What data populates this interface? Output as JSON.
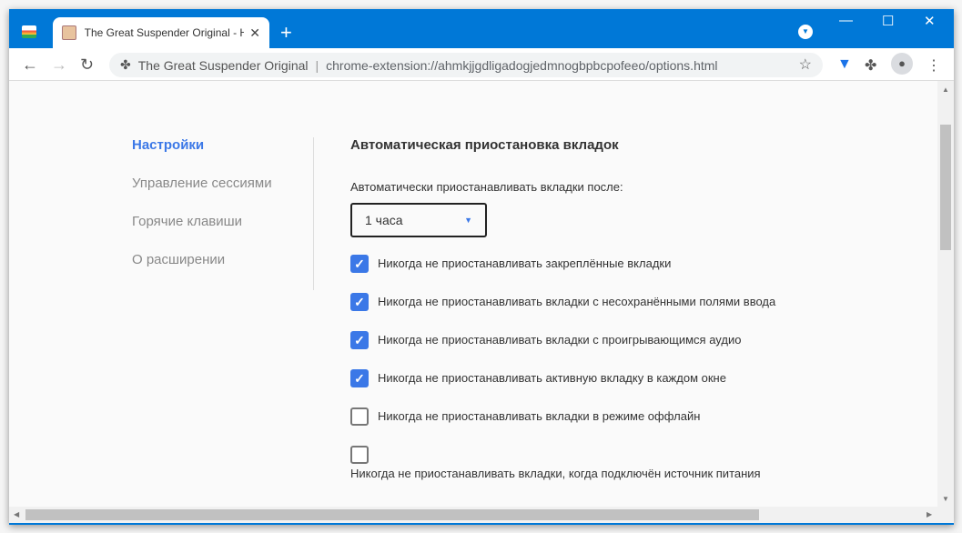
{
  "browser": {
    "tab_title": "The Great Suspender Original - H",
    "new_tab": "+",
    "tab_close": "✕",
    "omnibox": {
      "site": "The Great Suspender Original",
      "url": "chrome-extension://ahmkjjgdligadogjedmnogbpbcpofeeo/options.html"
    }
  },
  "sidebar": {
    "items": [
      {
        "label": "Настройки",
        "active": true
      },
      {
        "label": "Управление сессиями"
      },
      {
        "label": "Горячие клавиши"
      },
      {
        "label": "О расширении"
      }
    ]
  },
  "main": {
    "heading": "Автоматическая приостановка вкладок",
    "suspend_label": "Автоматически приостанавливать вкладки после:",
    "suspend_value": "1 часа",
    "options": [
      {
        "label": "Никогда не приостанавливать закреплённые вкладки",
        "checked": true
      },
      {
        "label": "Никогда не приостанавливать вкладки с несохранёнными полями ввода",
        "checked": true
      },
      {
        "label": "Никогда не приостанавливать вкладки с проигрывающимся аудио",
        "checked": true
      },
      {
        "label": "Никогда не приостанавливать активную вкладку в каждом окне",
        "checked": true
      },
      {
        "label": "Никогда не приостанавливать вкладки в режиме оффлайн",
        "checked": false
      },
      {
        "label": "Никогда не приостанавливать вкладки, когда подключён источник питания",
        "checked": false
      }
    ]
  },
  "colors": {
    "accent": "#3b78e7",
    "titlebar": "#0078d7"
  }
}
